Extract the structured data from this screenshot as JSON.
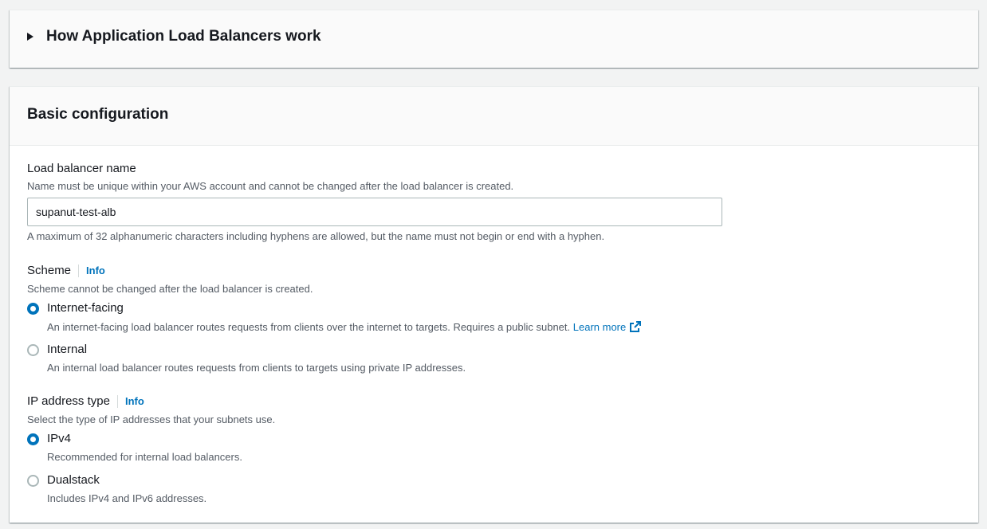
{
  "expandable": {
    "title": "How Application Load Balancers work"
  },
  "basic": {
    "title": "Basic configuration",
    "name_field": {
      "label": "Load balancer name",
      "description": "Name must be unique within your AWS account and cannot be changed after the load balancer is created.",
      "value": "supanut-test-alb",
      "constraint": "A maximum of 32 alphanumeric characters including hyphens are allowed, but the name must not begin or end with a hyphen."
    },
    "scheme": {
      "label": "Scheme",
      "info": "Info",
      "description": "Scheme cannot be changed after the load balancer is created.",
      "options": [
        {
          "label": "Internet-facing",
          "description": "An internet-facing load balancer routes requests from clients over the internet to targets. Requires a public subnet.",
          "link": "Learn more",
          "selected": true
        },
        {
          "label": "Internal",
          "description": "An internal load balancer routes requests from clients to targets using private IP addresses.",
          "selected": false
        }
      ]
    },
    "ip_type": {
      "label": "IP address type",
      "info": "Info",
      "description": "Select the type of IP addresses that your subnets use.",
      "options": [
        {
          "label": "IPv4",
          "description": "Recommended for internal load balancers.",
          "selected": true
        },
        {
          "label": "Dualstack",
          "description": "Includes IPv4 and IPv6 addresses.",
          "selected": false
        }
      ]
    }
  },
  "icons": {
    "expand": "caret-right-icon",
    "external": "external-link-icon"
  },
  "colors": {
    "accent": "#0073bb",
    "background": "#f2f3f3",
    "text": "#16191f",
    "secondary_text": "#545b64"
  }
}
